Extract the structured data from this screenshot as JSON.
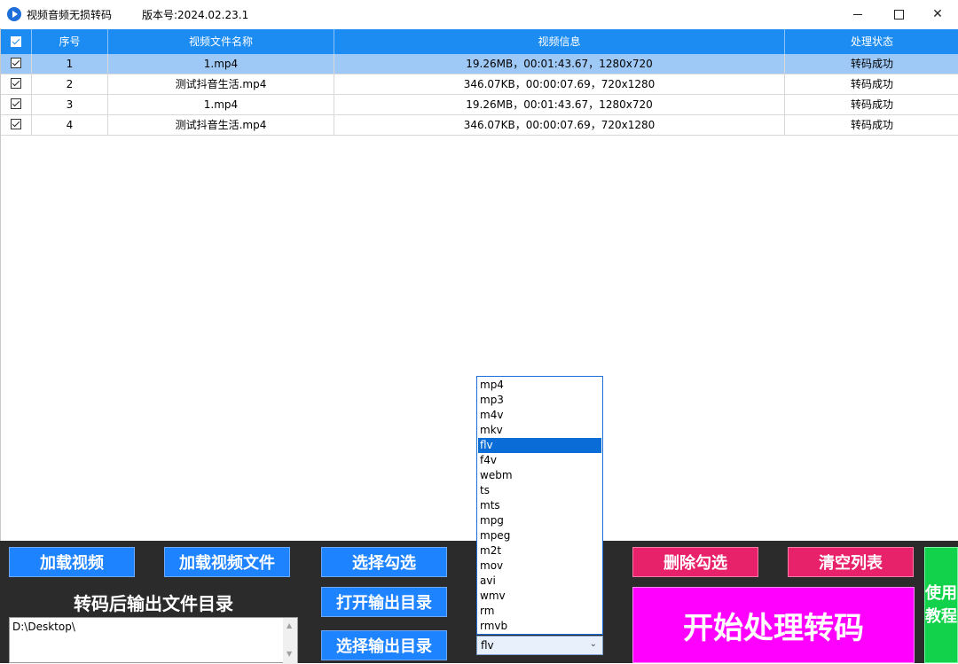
{
  "window": {
    "title": "视频音频无损转码",
    "version": "版本号:2024.02.23.1",
    "controls": {
      "minimize": "—",
      "maximize": "☐",
      "close": "✕"
    }
  },
  "table": {
    "columns": [
      "序号",
      "视频文件名称",
      "视频信息",
      "处理状态"
    ],
    "rows": [
      {
        "checked": true,
        "index": "1",
        "name": "1.mp4",
        "info": "19.26MB，00:01:43.67，1280x720",
        "status": "转码成功"
      },
      {
        "checked": true,
        "index": "2",
        "name": "测试抖音生活.mp4",
        "info": "346.07KB，00:00:07.69，720x1280",
        "status": "转码成功"
      },
      {
        "checked": true,
        "index": "3",
        "name": "1.mp4",
        "info": "19.26MB，00:01:43.67，1280x720",
        "status": "转码成功"
      },
      {
        "checked": true,
        "index": "4",
        "name": "测试抖音生活.mp4",
        "info": "346.07KB，00:00:07.69，720x1280",
        "status": "转码成功"
      }
    ],
    "selected_row": 0
  },
  "buttons": {
    "load_video": "加载视频",
    "load_video_file": "加载视频文件",
    "select_checked": "选择勾选",
    "open_output_dir": "打开输出目录",
    "choose_output_dir": "选择输出目录",
    "delete_checked": "删除勾选",
    "clear_list": "清空列表",
    "start": "开始处理转码",
    "tutorial": "使用教程"
  },
  "output": {
    "label": "转码后输出文件目录",
    "path": "D:\\Desktop\\"
  },
  "format": {
    "selected": "flv",
    "options": [
      "mp4",
      "mp3",
      "m4v",
      "mkv",
      "flv",
      "f4v",
      "webm",
      "ts",
      "mts",
      "mpg",
      "mpeg",
      "m2t",
      "mov",
      "avi",
      "wmv",
      "rm",
      "rmvb"
    ],
    "highlighted": "flv"
  },
  "colors": {
    "header": "#1c8cf2",
    "selected_row": "#9ec9f7",
    "button_blue": "#1e83ff",
    "button_red": "#e8226a",
    "button_magenta": "#ff00ff",
    "button_green": "#11d24a",
    "panel": "#2b2b2b"
  }
}
